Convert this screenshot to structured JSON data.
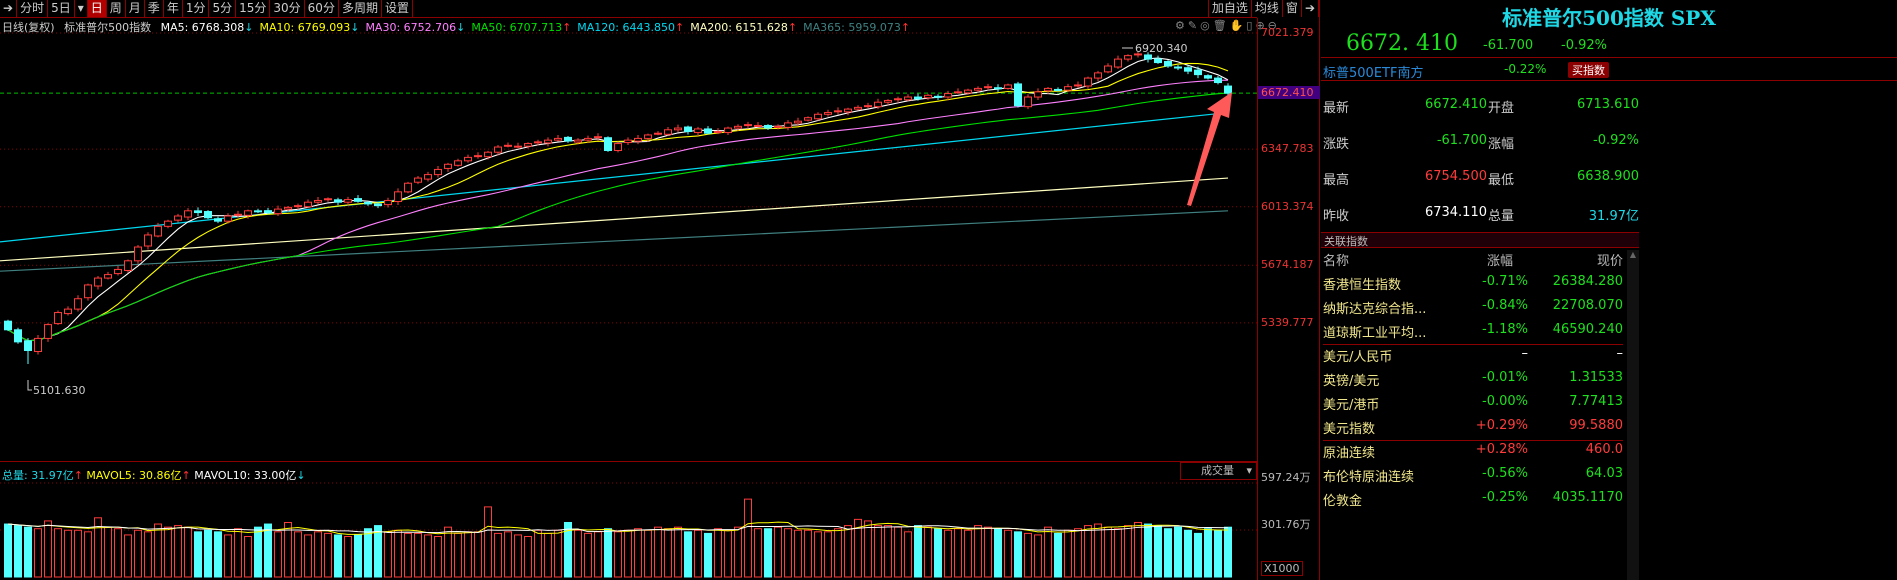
{
  "toolbar": {
    "items": [
      "分时",
      "5日",
      "▾",
      "日",
      "周",
      "月",
      "季",
      "年",
      "1分",
      "5分",
      "15分",
      "30分",
      "60分",
      "多周期",
      "设置"
    ],
    "active": "日",
    "right": [
      "加自选",
      "均线",
      "窗"
    ]
  },
  "info": {
    "label": "日线(复权)",
    "name": "标准普尔500指数",
    "ma": [
      {
        "t": "MA5: 6768.308",
        "a": "↓",
        "color": "#ffffff",
        "ac": "#1ed8e6"
      },
      {
        "t": "MA10: 6769.093",
        "a": "↓",
        "color": "#ffff00",
        "ac": "#1ed8e6"
      },
      {
        "t": "MA30: 6752.706",
        "a": "↓",
        "color": "#ff80ff",
        "ac": "#1ed8e6"
      },
      {
        "t": "MA50: 6707.713",
        "a": "↑",
        "color": "#00e000",
        "ac": "#ff3030"
      },
      {
        "t": "MA120: 6443.850",
        "a": "↑",
        "color": "#00d8f0",
        "ac": "#ff3030"
      },
      {
        "t": "MA200: 6151.628",
        "a": "↑",
        "color": "#ffffc0",
        "ac": "#ff3030"
      },
      {
        "t": "MA365: 5959.073",
        "a": "↑",
        "color": "#408080",
        "ac": "#ff3030"
      }
    ]
  },
  "yaxis": {
    "labels": [
      "7021.379",
      "6347.783",
      "6013.374",
      "5674.187",
      "5339.777"
    ],
    "current": "6672.410"
  },
  "annotations": {
    "high": "6920.340",
    "low": "5101.630"
  },
  "volume": {
    "total": "总量: 31.97亿",
    "mavol5": "MAVOL5: 30.86亿",
    "mavol10": "MAVOL10: 33.00亿",
    "selector": "成交量",
    "axis": [
      "597.24万",
      "301.76万"
    ],
    "unit": "X1000"
  },
  "chart_data": {
    "type": "candlestick",
    "ylim": [
      5000,
      7050
    ],
    "close": [
      5300,
      5230,
      5180,
      5250,
      5330,
      5400,
      5420,
      5480,
      5560,
      5600,
      5620,
      5650,
      5700,
      5780,
      5850,
      5900,
      5930,
      5960,
      5990,
      5980,
      5950,
      5930,
      5960,
      5970,
      5990,
      5985,
      5980,
      6000,
      6010,
      6020,
      6040,
      6050,
      6060,
      6040,
      6055,
      6045,
      6030,
      6020,
      6050,
      6100,
      6150,
      6180,
      6200,
      6230,
      6260,
      6280,
      6300,
      6310,
      6330,
      6360,
      6370,
      6365,
      6380,
      6390,
      6400,
      6410,
      6395,
      6400,
      6410,
      6420,
      6340,
      6380,
      6400,
      6410,
      6430,
      6440,
      6460,
      6470,
      6450,
      6465,
      6440,
      6450,
      6470,
      6480,
      6490,
      6485,
      6470,
      6480,
      6500,
      6510,
      6530,
      6550,
      6560,
      6570,
      6580,
      6590,
      6600,
      6620,
      6630,
      6640,
      6650,
      6640,
      6660,
      6650,
      6670,
      6680,
      6690,
      6700,
      6710,
      6700,
      6720,
      6600,
      6650,
      6680,
      6700,
      6690,
      6710,
      6720,
      6760,
      6790,
      6830,
      6870,
      6890,
      6900,
      6870,
      6850,
      6830,
      6820,
      6800,
      6780,
      6760,
      6734.11,
      6672.41
    ],
    "volume": [
      34,
      33,
      32,
      31,
      36,
      31,
      30,
      30,
      29,
      38,
      32,
      31,
      27,
      30,
      29,
      34,
      32,
      33,
      32,
      29,
      30,
      29,
      27,
      31,
      26,
      32,
      34,
      29,
      35,
      29,
      27,
      29,
      28,
      27,
      26,
      27,
      31,
      33,
      29,
      30,
      28,
      28,
      27,
      26,
      32,
      28,
      29,
      29,
      45,
      28,
      29,
      27,
      26,
      30,
      28,
      30,
      35,
      30,
      28,
      29,
      31,
      29,
      30,
      31,
      30,
      32,
      31,
      32,
      29,
      30,
      28,
      31,
      30,
      32,
      50,
      31,
      31,
      32,
      31,
      30,
      30,
      29,
      29,
      31,
      33,
      37,
      36,
      33,
      33,
      32,
      29,
      33,
      32,
      31,
      30,
      31,
      30,
      33,
      32,
      31,
      30,
      29,
      28,
      27,
      32,
      28,
      30,
      31,
      33,
      34,
      32,
      31,
      33,
      35,
      34,
      33,
      31,
      32,
      30,
      28,
      31,
      30,
      31.97
    ],
    "long_ma": [
      {
        "name": "MA120",
        "from": 5810,
        "to": 6560,
        "color": "#00d8f0"
      },
      {
        "name": "MA200",
        "from": 5700,
        "to": 6180,
        "color": "#ffffc0"
      },
      {
        "name": "MA365",
        "from": 5640,
        "to": 5990,
        "color": "#408080"
      }
    ]
  },
  "right": {
    "title": "标准普尔500指数 SPX",
    "price": "6672. 410",
    "change": "-61.700",
    "pct": "-0.92%",
    "etf": {
      "name": "标普500ETF南方",
      "pct": "-0.22%",
      "buy": "买指数"
    },
    "stats": [
      [
        "最新",
        "6672.410",
        "g",
        "开盘",
        "6713.610",
        "g"
      ],
      [
        "涨跌",
        "-61.700",
        "g",
        "涨幅",
        "-0.92%",
        "g"
      ],
      [
        "最高",
        "6754.500",
        "r",
        "最低",
        "6638.900",
        "g"
      ],
      [
        "昨收",
        "6734.110",
        "w",
        "总量",
        "31.97亿",
        "c"
      ]
    ],
    "related_title": "关联指数",
    "headers": [
      "名称",
      "涨幅",
      "现价"
    ],
    "rows": [
      [
        "香港恒生指数",
        "-0.71%",
        "26384.280",
        "g"
      ],
      [
        "纳斯达克综合指...",
        "-0.84%",
        "22708.070",
        "g"
      ],
      [
        "道琼斯工业平均...",
        "-1.18%",
        "46590.240",
        "g"
      ],
      [
        "美元/人民币",
        "–",
        "–",
        "w"
      ],
      [
        "英镑/美元",
        "-0.01%",
        "1.31533",
        "g"
      ],
      [
        "美元/港币",
        "-0.00%",
        "7.77413",
        "g"
      ],
      [
        "美元指数",
        "+0.29%",
        "99.5880",
        "r"
      ],
      [
        "原油连续",
        "+0.28%",
        "460.0",
        "r"
      ],
      [
        "布伦特原油连续",
        "-0.56%",
        "64.03",
        "g"
      ],
      [
        "伦敦金",
        "-0.25%",
        "4035.1170",
        "g"
      ]
    ]
  }
}
